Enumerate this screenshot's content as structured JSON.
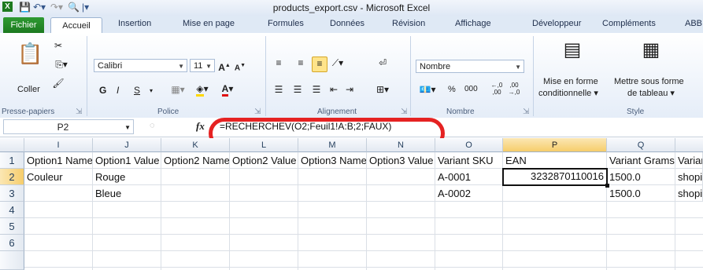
{
  "window": {
    "title": "products_export.csv  -  Microsoft Excel",
    "app_icon": "X"
  },
  "tabs": [
    "Fichier",
    "Accueil",
    "Insertion",
    "Mise en page",
    "Formules",
    "Données",
    "Révision",
    "Affichage",
    "Développeur",
    "Compléments",
    "ABB"
  ],
  "ribbon": {
    "clipboard": {
      "label": "Presse-papiers",
      "paste": "Coller"
    },
    "font": {
      "label": "Police",
      "name": "Calibri",
      "size": "11",
      "bold": "G",
      "italic": "I",
      "underline": "S"
    },
    "alignment": {
      "label": "Alignement"
    },
    "number": {
      "label": "Nombre",
      "format": "Nombre",
      "percent": "%",
      "thousands": "000"
    },
    "style": {
      "label": "Style",
      "conditional_l1": "Mise en forme",
      "conditional_l2": "conditionnelle ▾",
      "table_l1": "Mettre sous forme",
      "table_l2": "de tableau ▾"
    }
  },
  "formula_bar": {
    "name_box": "P2",
    "fx": "fx",
    "formula": "=RECHERCHEV(O2;Feuil1!A:B;2;FAUX)"
  },
  "grid": {
    "columns": [
      "I",
      "J",
      "K",
      "L",
      "M",
      "N",
      "O",
      "P",
      "Q",
      ""
    ],
    "rows": [
      "1",
      "2",
      "3",
      "4",
      "5",
      "6"
    ],
    "cells": [
      [
        "Option1 Name",
        "Option1 Value",
        "Option2 Name",
        "Option2 Value",
        "Option3 Name",
        "Option3 Value",
        "Variant SKU",
        "EAN",
        "Variant Grams",
        "Variant"
      ],
      [
        "Couleur",
        "Rouge",
        "",
        "",
        "",
        "",
        "A-0001",
        "3232870110016",
        "1500.0",
        "shopify"
      ],
      [
        "",
        "Bleue",
        "",
        "",
        "",
        "",
        "A-0002",
        "",
        "1500.0",
        "shopify"
      ],
      [
        "",
        "",
        "",
        "",
        "",
        "",
        "",
        "",
        "",
        ""
      ],
      [
        "",
        "",
        "",
        "",
        "",
        "",
        "",
        "",
        "",
        ""
      ],
      [
        "",
        "",
        "",
        "",
        "",
        "",
        "",
        "",
        "",
        ""
      ]
    ],
    "selected_cell": "P2"
  },
  "colors": {
    "fichier_green": "#1d7a20",
    "selection_orange": "#f6cd6b",
    "annotation_red": "#e52222"
  }
}
